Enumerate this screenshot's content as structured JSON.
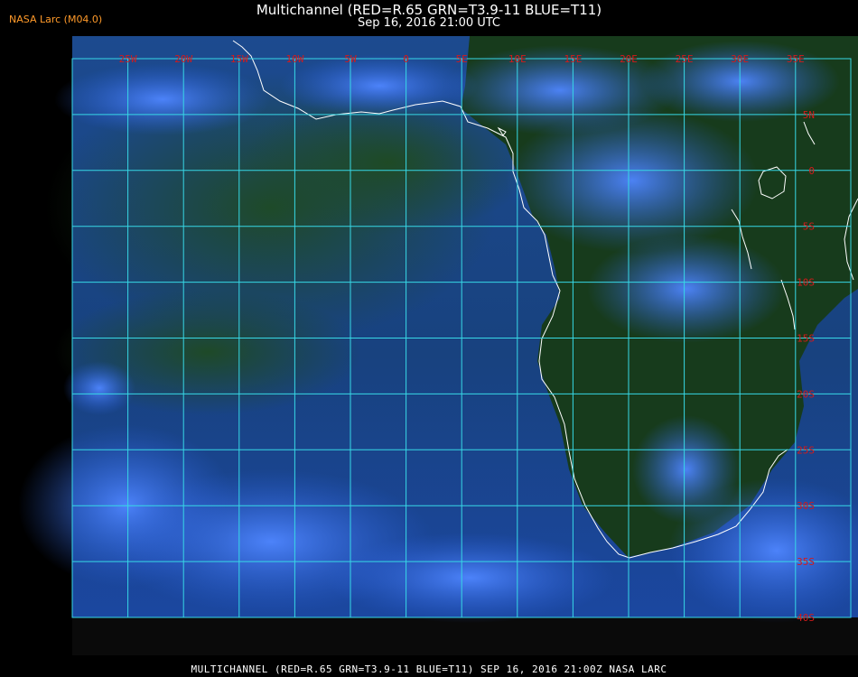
{
  "header": {
    "credit": "NASA Larc (M04.0)",
    "title": "Multichannel (RED=R.65 GRN=T3.9-11 BLUE=T11)",
    "subtitle": "Sep 16, 2016 21:00 UTC"
  },
  "footer": {
    "caption": "MULTICHANNEL (RED=R.65 GRN=T3.9-11 BLUE=T11) SEP 16, 2016 21:00Z  NASA LARC"
  },
  "map": {
    "longitude_labels": [
      "25W",
      "20W",
      "15W",
      "10W",
      "5W",
      "0",
      "5E",
      "10E",
      "15E",
      "20E",
      "25E",
      "30E",
      "35E"
    ],
    "latitude_labels": [
      "5N",
      "0",
      "5S",
      "10S",
      "15S",
      "20S",
      "25S",
      "30S",
      "35S",
      "40S"
    ],
    "colors": {
      "grid": "#37d8e6",
      "tick_labels": "#d41a1a",
      "coastline": "#ffffff",
      "ocean": "#17408a",
      "land": "#163a1a",
      "cloud": "#3f78ff"
    }
  }
}
